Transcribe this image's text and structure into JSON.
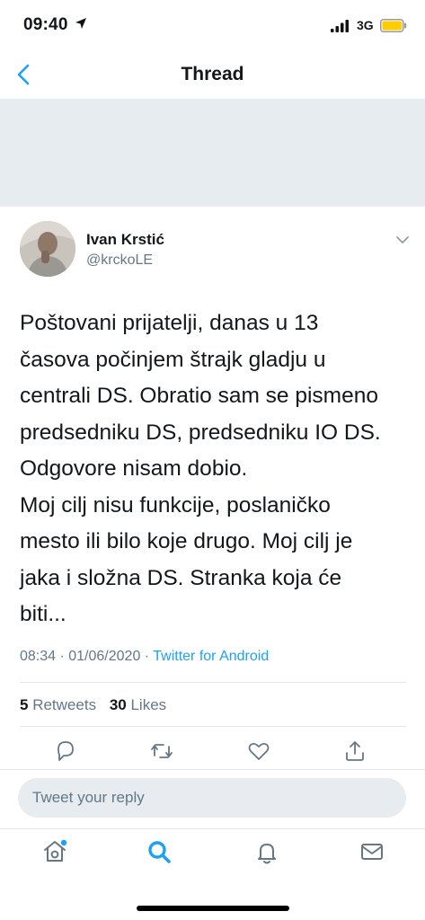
{
  "status_bar": {
    "time": "09:40",
    "network": "3G",
    "battery_color": "#ffcc00"
  },
  "nav": {
    "back_icon": "chevron-left-icon",
    "title": "Thread"
  },
  "tweet": {
    "author_name": "Ivan Krstić",
    "author_handle": "@krckoLE",
    "text_lines": [
      "Poštovani prijatelji, danas u 13",
      "časova počinjem štrajk gladju u",
      "centrali DS. Obratio sam se pismeno",
      "predsedniku DS, predsedniku IO DS.",
      "Odgovore nisam dobio.",
      "Moj cilj nisu funkcije, poslaničko",
      "mesto ili bilo koje drugo. Moj cilj je",
      "jaka i složna DS. Stranka koja će",
      "biti..."
    ],
    "timestamp": "08:34 · 01/06/2020 · ",
    "source": "Twitter for Android",
    "retweets_count": "5",
    "retweets_label": "Retweets",
    "likes_count": "30",
    "likes_label": "Likes"
  },
  "actions": [
    "reply-icon",
    "retweet-icon",
    "like-icon",
    "share-icon"
  ],
  "reply": {
    "placeholder": "Tweet your reply"
  },
  "tab_bar": [
    "home-icon",
    "search-icon",
    "notifications-icon",
    "messages-icon"
  ],
  "colors": {
    "accent": "#1da1f2",
    "secondary_text": "#657786",
    "banner": "#e6ecf0"
  }
}
